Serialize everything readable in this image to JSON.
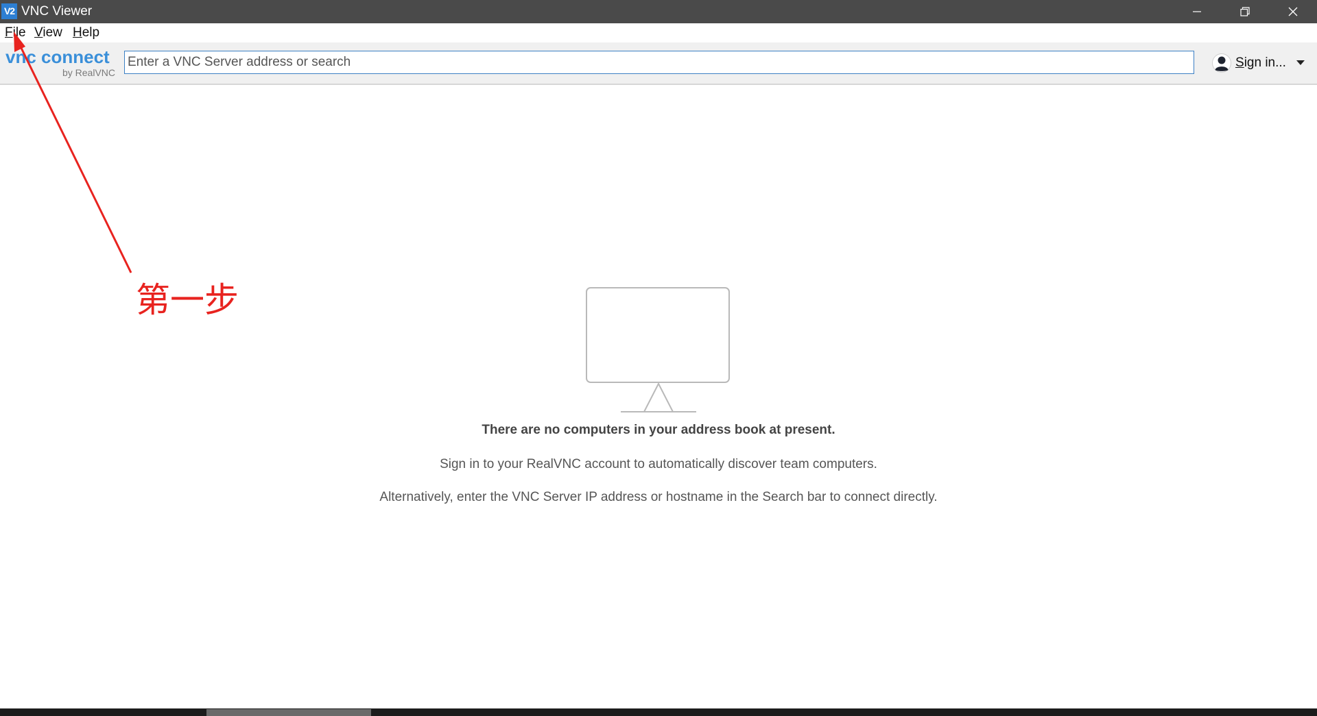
{
  "window": {
    "icon_text": "V2",
    "title": "VNC Viewer"
  },
  "menu": {
    "file": {
      "mnemonic": "F",
      "rest": "ile"
    },
    "view": {
      "mnemonic": "V",
      "rest": "iew"
    },
    "help": {
      "mnemonic": "H",
      "rest": "elp"
    }
  },
  "toolbar": {
    "logo_main": "vnc connect",
    "logo_sub": "by RealVNC",
    "search_placeholder": "Enter a VNC Server address or search",
    "search_value": "",
    "signin": {
      "mnemonic": "S",
      "rest": "ign in..."
    }
  },
  "empty_state": {
    "title": "There are no computers in your address book at present.",
    "line1": "Sign in to your RealVNC account to automatically discover team computers.",
    "line2": "Alternatively, enter the VNC Server IP address or hostname in the Search bar to connect directly."
  },
  "annotation": {
    "label": "第一步",
    "color": "#e8231f"
  },
  "colors": {
    "titlebar": "#4a4a4a",
    "accent": "#3a8fd9",
    "toolbar": "#f0f0f0"
  }
}
